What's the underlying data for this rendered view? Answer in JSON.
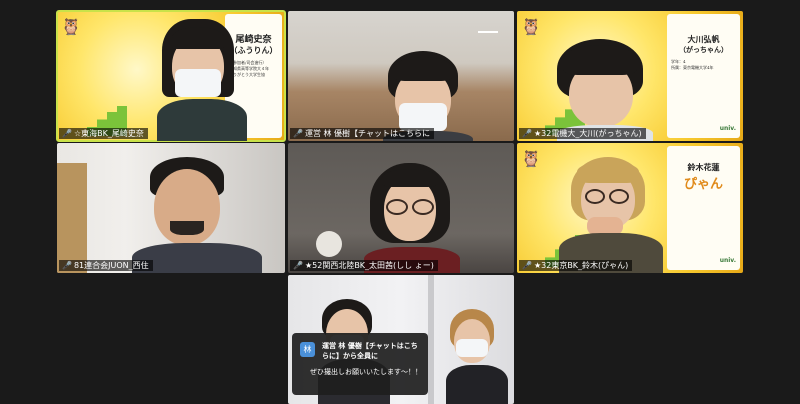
{
  "tiles": [
    {
      "name": "☆東海BK_尾崎史奈",
      "card_title": "尾崎史奈",
      "card_sub": "（ふうりん）",
      "card_lines": [
        "（参加者/司会進行）",
        "愛知県高等学院大４年",
        "ありがとう大学生協"
      ]
    },
    {
      "name": "運営 林 優樹【チャットはこちらに"
    },
    {
      "name": "★32電機大_大川(がっちゃん)",
      "card_title": "大川弘帆",
      "card_sub": "（がっちゃん）",
      "card_lines": [
        "学年：4",
        "所属：東京電機大学4年"
      ],
      "logo": "univ."
    },
    {
      "name": "81連合会JUON_西住"
    },
    {
      "name": "★52関西北陸BK_太田茜(しし ょー)"
    },
    {
      "name": "★32東京BK_鈴木(ぴゃん)",
      "card_title": "鈴木花蓮",
      "card_sub": "ぴゃん",
      "logo": "univ."
    },
    {
      "name": ""
    }
  ],
  "chat_popup": {
    "avatar_letter": "林",
    "sender": "運営 林 優樹【チャットはこちらに】から全員に",
    "message": "ぜひ撮出しお願いいたします〜！！"
  },
  "colors": {
    "active_speaker_border": "#c9e24a",
    "mic_muted": "#e8453c"
  }
}
